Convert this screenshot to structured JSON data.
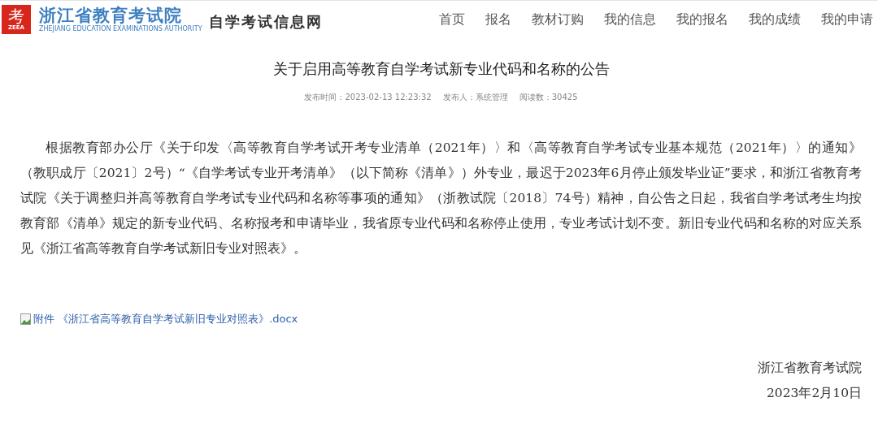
{
  "header": {
    "logo": {
      "mark": "考",
      "abbr": "ZEEA"
    },
    "org_name": "浙江省教育考试院",
    "org_name_en": "ZHEJIANG EDUCATION EXAMINATIONS AUTHORITY",
    "site_name": "自学考试信息网"
  },
  "nav": [
    {
      "label": "首页"
    },
    {
      "label": "报名"
    },
    {
      "label": "教材订购"
    },
    {
      "label": "我的信息"
    },
    {
      "label": "我的报名"
    },
    {
      "label": "我的成绩"
    },
    {
      "label": "我的申请"
    }
  ],
  "article": {
    "title": "关于启用高等教育自学考试新专业代码和名称的公告",
    "meta": [
      {
        "label": "发布时间：",
        "value": "2023-02-13 12:23:32"
      },
      {
        "label": "发布人：",
        "value": "系统管理"
      },
      {
        "label": "阅读数：",
        "value": "30425"
      }
    ],
    "body": "根据教育部办公厅《关于印发〈高等教育自学考试开考专业清单（2021年）〉和〈高等教育自学考试专业基本规范（2021年）〉的通知》（教职成厅〔2021〕2号）“《自学考试专业开考清单》（以下简称《清单》）外专业，最迟于2023年6月停止颁发毕业证”要求，和浙江省教育考试院《关于调整归并高等教育自学考试专业代码和名称等事项的通知》（浙教试院〔2018〕74号）精神，自公告之日起，我省自学考试考生均按教育部《清单》规定的新专业代码、名称报考和申请毕业，我省原专业代码和名称停止使用，专业考试计划不变。新旧专业代码和名称的对应关系见《浙江省高等教育自学考试新旧专业对照表》。",
    "attachment": "附件 《浙江省高等教育自学考试新旧专业对照表》.docx",
    "signature": [
      "浙江省教育考试院",
      "2023年2月10日"
    ]
  }
}
